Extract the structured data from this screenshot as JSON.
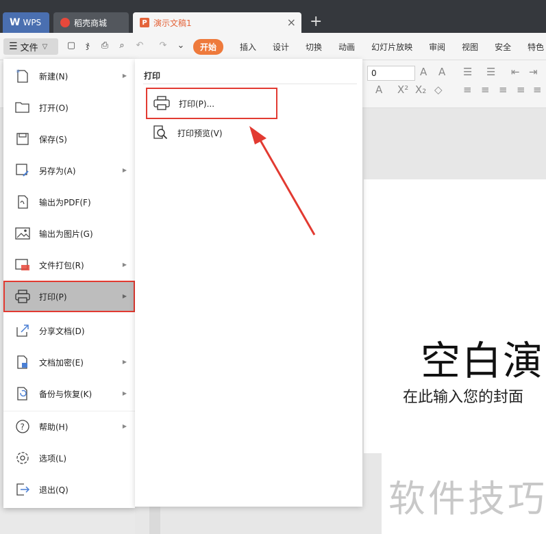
{
  "tabs": {
    "wps": "WPS",
    "store": "稻壳商城",
    "doc": "演示文稿1"
  },
  "toolbar": {
    "file_label": "文件",
    "ribbon_tabs": [
      "开始",
      "插入",
      "设计",
      "切换",
      "动画",
      "幻灯片放映",
      "审阅",
      "视图",
      "安全",
      "特色"
    ],
    "font_size_value": "0"
  },
  "file_menu": {
    "items": [
      {
        "label": "新建(N)",
        "icon": "new-file-icon",
        "has_submenu": true
      },
      {
        "label": "打开(O)",
        "icon": "folder-open-icon",
        "has_submenu": false
      },
      {
        "label": "保存(S)",
        "icon": "save-icon",
        "has_submenu": false
      },
      {
        "label": "另存为(A)",
        "icon": "save-as-icon",
        "has_submenu": true
      },
      {
        "label": "输出为PDF(F)",
        "icon": "export-pdf-icon",
        "has_submenu": false
      },
      {
        "label": "输出为图片(G)",
        "icon": "export-image-icon",
        "has_submenu": false
      },
      {
        "label": "文件打包(R)",
        "icon": "package-icon",
        "has_submenu": true
      },
      {
        "label": "打印(P)",
        "icon": "printer-icon",
        "has_submenu": true,
        "highlighted": true
      },
      {
        "label": "分享文档(D)",
        "icon": "share-icon",
        "has_submenu": false
      },
      {
        "label": "文档加密(E)",
        "icon": "encrypt-icon",
        "has_submenu": true
      },
      {
        "label": "备份与恢复(K)",
        "icon": "backup-icon",
        "has_submenu": true
      },
      {
        "label": "帮助(H)",
        "icon": "help-icon",
        "has_submenu": true
      },
      {
        "label": "选项(L)",
        "icon": "settings-icon",
        "has_submenu": false
      },
      {
        "label": "退出(Q)",
        "icon": "exit-icon",
        "has_submenu": false
      }
    ]
  },
  "print_menu": {
    "header": "打印",
    "items": [
      {
        "label": "打印(P)...",
        "icon": "printer-icon"
      },
      {
        "label": "打印预览(V)",
        "icon": "print-preview-icon"
      }
    ]
  },
  "slide": {
    "title": "空白演",
    "subtitle": "在此输入您的封面",
    "watermark": "软件技巧"
  },
  "colors": {
    "accent": "#ee7a3c",
    "highlight_border": "#e23a31",
    "tabbar_bg": "#35383d"
  }
}
